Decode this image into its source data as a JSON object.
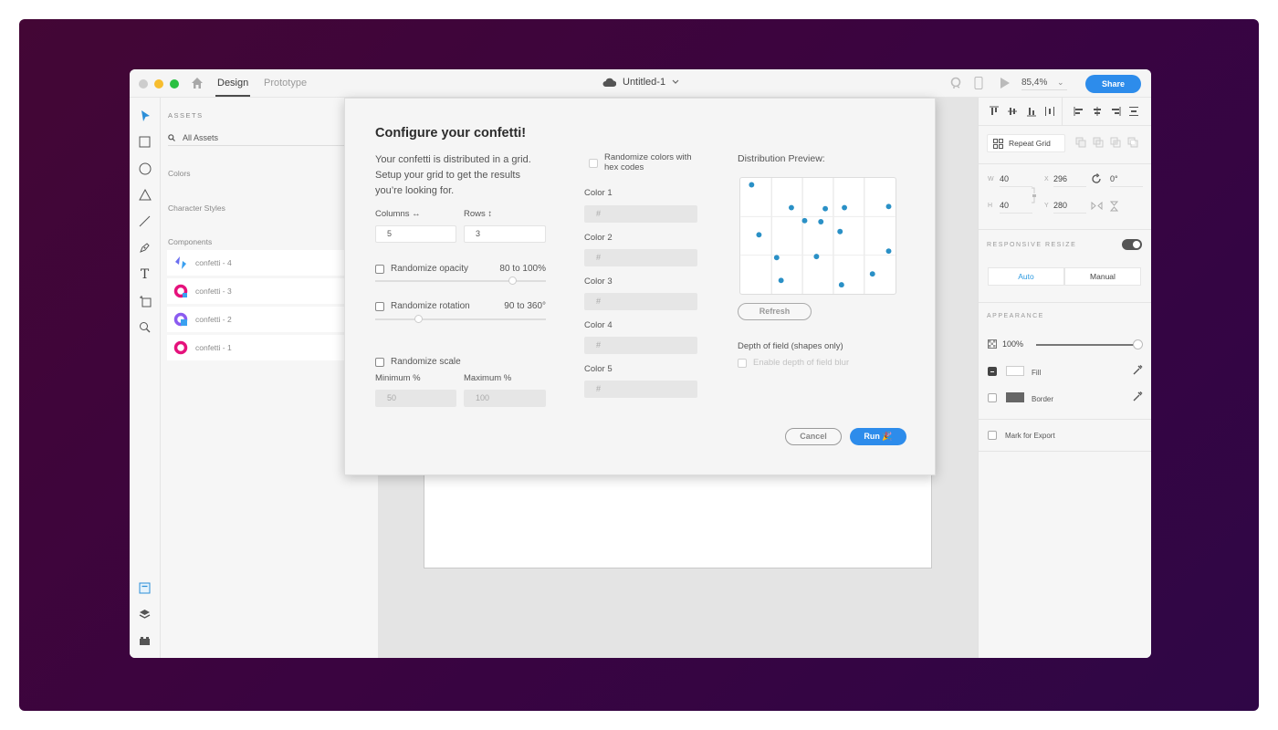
{
  "titlebar": {
    "tabs": [
      {
        "label": "Design",
        "active": true
      },
      {
        "label": "Prototype",
        "active": false
      }
    ],
    "document_title": "Untitled-1",
    "zoom_level": "85,4%",
    "share_label": "Share",
    "accent_color": "#2d8ceb"
  },
  "toolbar": {
    "tools": [
      "select-icon",
      "rectangle-icon",
      "ellipse-icon",
      "polygon-icon",
      "line-icon",
      "pen-icon",
      "text-icon",
      "artboard-icon",
      "zoom-icon"
    ],
    "bottom": [
      "assets-icon",
      "layers-icon",
      "plugins-icon"
    ]
  },
  "assets": {
    "title": "ASSETS",
    "search_value": "All Assets",
    "sections": {
      "colors": "Colors",
      "character_styles": "Character Styles",
      "components": "Components"
    },
    "components": [
      {
        "label": "confetti - 4"
      },
      {
        "label": "confetti - 3"
      },
      {
        "label": "confetti - 2"
      },
      {
        "label": "confetti - 1"
      }
    ]
  },
  "dialog": {
    "title": "Configure your confetti!",
    "description": "Your confetti is distributed in a grid. Setup your grid to get the results you’re looking for.",
    "columns_label": "Columns ↔",
    "rows_label": "Rows ↕",
    "columns_value": "5",
    "rows_value": "3",
    "randomize_opacity": {
      "label": "Randomize opacity",
      "range": "80  to 100%",
      "checked": false,
      "slider_fraction": 0.8
    },
    "randomize_rotation": {
      "label": "Randomize rotation",
      "range": "90  to 360°",
      "checked": false,
      "slider_fraction": 0.25
    },
    "randomize_scale": {
      "label": "Randomize scale",
      "checked": false
    },
    "min_label": "Minimum %",
    "max_label": "Maximum %",
    "min_value": "50",
    "max_value": "100",
    "randomize_colors_label": "Randomize colors with hex codes",
    "colors": [
      {
        "label": "Color 1",
        "placeholder": "#"
      },
      {
        "label": "Color 2",
        "placeholder": "#"
      },
      {
        "label": "Color 3",
        "placeholder": "#"
      },
      {
        "label": "Color 4",
        "placeholder": "#"
      },
      {
        "label": "Color 5",
        "placeholder": "#"
      }
    ],
    "preview_label": "Distribution Preview:",
    "preview": {
      "columns": 5,
      "rows": 3,
      "dot_color": "#2a90c6",
      "points": [
        [
          0.05,
          0.03
        ],
        [
          0.32,
          0.24
        ],
        [
          0.41,
          0.36
        ],
        [
          0.55,
          0.25
        ],
        [
          0.68,
          0.24
        ],
        [
          0.98,
          0.23
        ],
        [
          0.1,
          0.49
        ],
        [
          0.52,
          0.37
        ],
        [
          0.65,
          0.46
        ],
        [
          0.22,
          0.7
        ],
        [
          0.49,
          0.69
        ],
        [
          0.98,
          0.64
        ],
        [
          0.25,
          0.91
        ],
        [
          0.87,
          0.85
        ],
        [
          0.66,
          0.95
        ]
      ]
    },
    "refresh_label": "Refresh",
    "dof_label": "Depth of field (shapes only)",
    "dof_checkbox_label": "Enable depth of field blur",
    "cancel_label": "Cancel",
    "run_label": "Run 🎉"
  },
  "properties": {
    "repeat_grid_label": "Repeat Grid",
    "w_label": "W",
    "w_value": "40",
    "h_label": "H",
    "h_value": "40",
    "x_label": "X",
    "x_value": "296",
    "y_label": "Y",
    "y_value": "280",
    "rotation_value": "0°",
    "responsive_label": "RESPONSIVE RESIZE",
    "responsive_on": true,
    "auto_label": "Auto",
    "manual_label": "Manual",
    "appearance_label": "APPEARANCE",
    "opacity_value": "100%",
    "fill_label": "Fill",
    "border_label": "Border",
    "export_label": "Mark for Export"
  }
}
